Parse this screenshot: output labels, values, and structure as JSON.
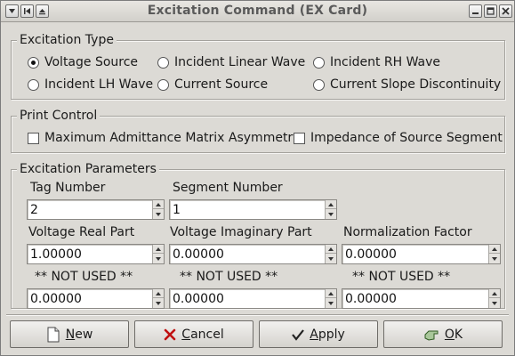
{
  "window": {
    "title": "Excitation Command (EX Card)"
  },
  "excitation_type": {
    "legend": "Excitation Type",
    "options": [
      {
        "label": "Voltage Source",
        "checked": true
      },
      {
        "label": "Incident Linear Wave",
        "checked": false
      },
      {
        "label": "Incident RH Wave",
        "checked": false
      },
      {
        "label": "Incident LH Wave",
        "checked": false
      },
      {
        "label": "Current Source",
        "checked": false
      },
      {
        "label": "Current Slope Discontinuity",
        "checked": false
      }
    ]
  },
  "print_control": {
    "legend": "Print Control",
    "options": [
      {
        "label": "Maximum Admittance Matrix Asymmetry",
        "checked": false
      },
      {
        "label": "Impedance of Source Segment",
        "checked": false
      }
    ]
  },
  "parameters": {
    "legend": "Excitation Parameters",
    "tag_number": {
      "label": "Tag Number",
      "value": "2"
    },
    "segment_number": {
      "label": "Segment Number",
      "value": "1"
    },
    "voltage_real": {
      "label": "Voltage Real Part",
      "value": "1.00000"
    },
    "voltage_imag": {
      "label": "Voltage Imaginary Part",
      "value": "0.00000"
    },
    "normalization": {
      "label": "Normalization Factor",
      "value": "0.00000"
    },
    "unused_1": {
      "label": "** NOT USED **",
      "value": "0.00000"
    },
    "unused_2": {
      "label": "** NOT USED **",
      "value": "0.00000"
    },
    "unused_3": {
      "label": "** NOT USED **",
      "value": "0.00000"
    }
  },
  "buttons": {
    "new": {
      "mnemonic": "N",
      "rest": "ew"
    },
    "cancel": {
      "mnemonic": "C",
      "rest": "ancel"
    },
    "apply": {
      "mnemonic": "A",
      "rest": "pply"
    },
    "ok": {
      "mnemonic": "O",
      "rest": "K"
    }
  }
}
